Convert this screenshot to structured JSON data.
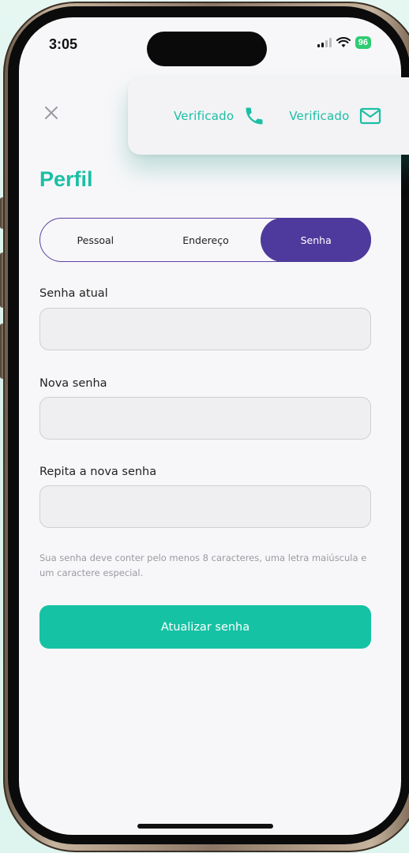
{
  "status_bar": {
    "time": "3:05",
    "battery": "96"
  },
  "verification": {
    "phone_label": "Verificado",
    "email_label": "Verificado",
    "accent_color": "#1bbfa4"
  },
  "profile": {
    "title": "Perfil",
    "tabs": [
      {
        "label": "Pessoal",
        "active": false
      },
      {
        "label": "Endereço",
        "active": false
      },
      {
        "label": "Senha",
        "active": true
      }
    ]
  },
  "form": {
    "current_password_label": "Senha atual",
    "current_password_value": "",
    "new_password_label": "Nova senha",
    "new_password_value": "",
    "repeat_password_label": "Repita a nova senha",
    "repeat_password_value": "",
    "helper_text": "Sua senha deve conter pelo menos 8 caracteres, uma letra maiúscula e um caractere especial.",
    "submit_label": "Atualizar senha"
  },
  "colors": {
    "primary": "#16c2a4",
    "tab_active": "#4e3a9c"
  }
}
